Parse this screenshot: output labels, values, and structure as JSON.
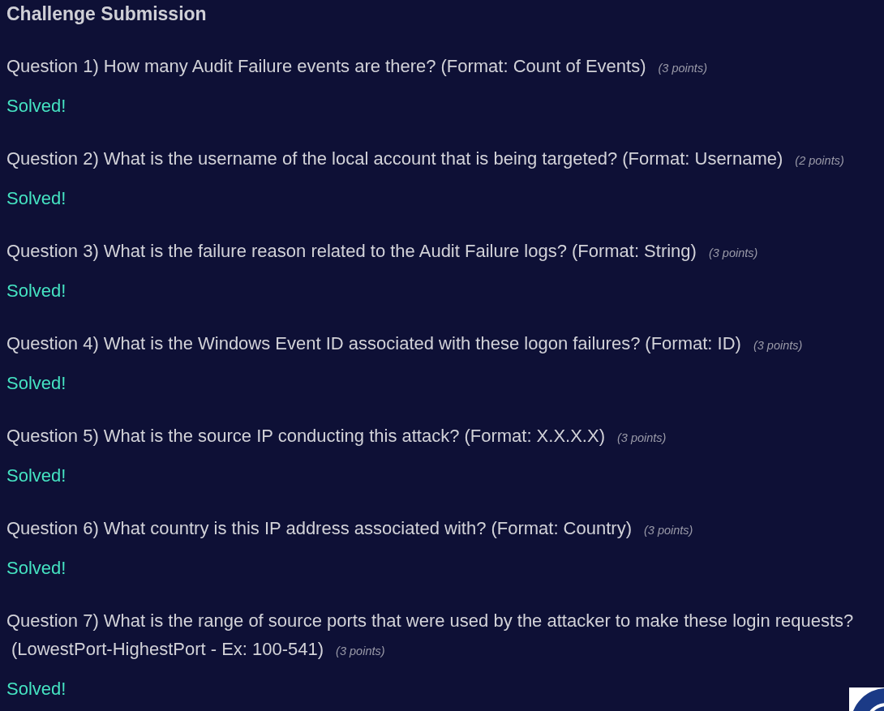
{
  "title": "Challenge Submission",
  "questions": [
    {
      "text": "Question 1) How many Audit Failure events are there?",
      "format": "(Format: Count of Events)",
      "points": "(3 points)",
      "status": "Solved!"
    },
    {
      "text": "Question 2) What is the username of the local account that is being targeted?",
      "format": "(Format: Username)",
      "points": "(2 points)",
      "status": "Solved!"
    },
    {
      "text": "Question 3) What is the failure reason related to the Audit Failure logs?",
      "format": "(Format: String)",
      "points": "(3 points)",
      "status": "Solved!"
    },
    {
      "text": "Question 4) What is the Windows Event ID associated with these logon failures?",
      "format": "(Format: ID)",
      "points": "(3 points)",
      "status": "Solved!"
    },
    {
      "text": "Question 5) What is the source IP conducting this attack?",
      "format": "(Format: X.X.X.X)",
      "points": "(3 points)",
      "status": "Solved!"
    },
    {
      "text": "Question 6) What country is this IP address associated with?",
      "format": "(Format: Country)",
      "points": "(3 points)",
      "status": "Solved!"
    },
    {
      "text": "Question 7) What is the range of source ports that were used by the attacker to make these login requests?",
      "format": "(LowestPort-HighestPort - Ex: 100-541)",
      "points": "(3 points)",
      "status": "Solved!"
    }
  ]
}
